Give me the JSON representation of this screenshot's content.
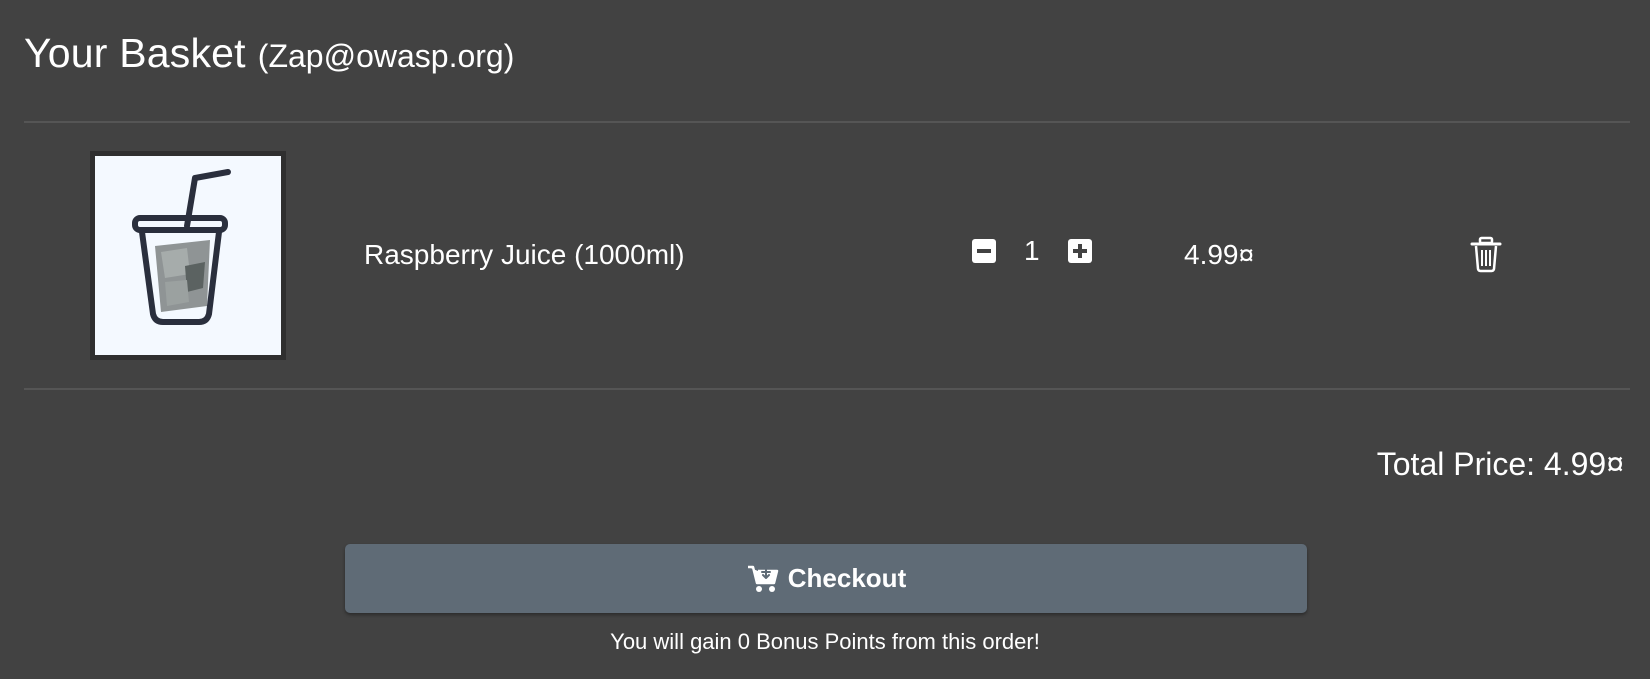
{
  "basket": {
    "title": "Your Basket",
    "user": "(Zap@owasp.org)"
  },
  "items": [
    {
      "name": "Raspberry Juice (1000ml)",
      "quantity": "1",
      "price": "4.99¤",
      "image_icon": "juice-cup-icon"
    }
  ],
  "total": {
    "label": "Total Price: 4.99¤"
  },
  "checkout": {
    "label": "Checkout",
    "icon": "cart-arrow-icon",
    "bonus_text": "You will gain 0 Bonus Points from this order!"
  },
  "colors": {
    "background": "#424242",
    "divider": "#555555",
    "button": "#5f6b76",
    "text": "#ffffff",
    "thumb_bg": "#f4f9ff",
    "icon_dark": "#2a2f3d"
  }
}
